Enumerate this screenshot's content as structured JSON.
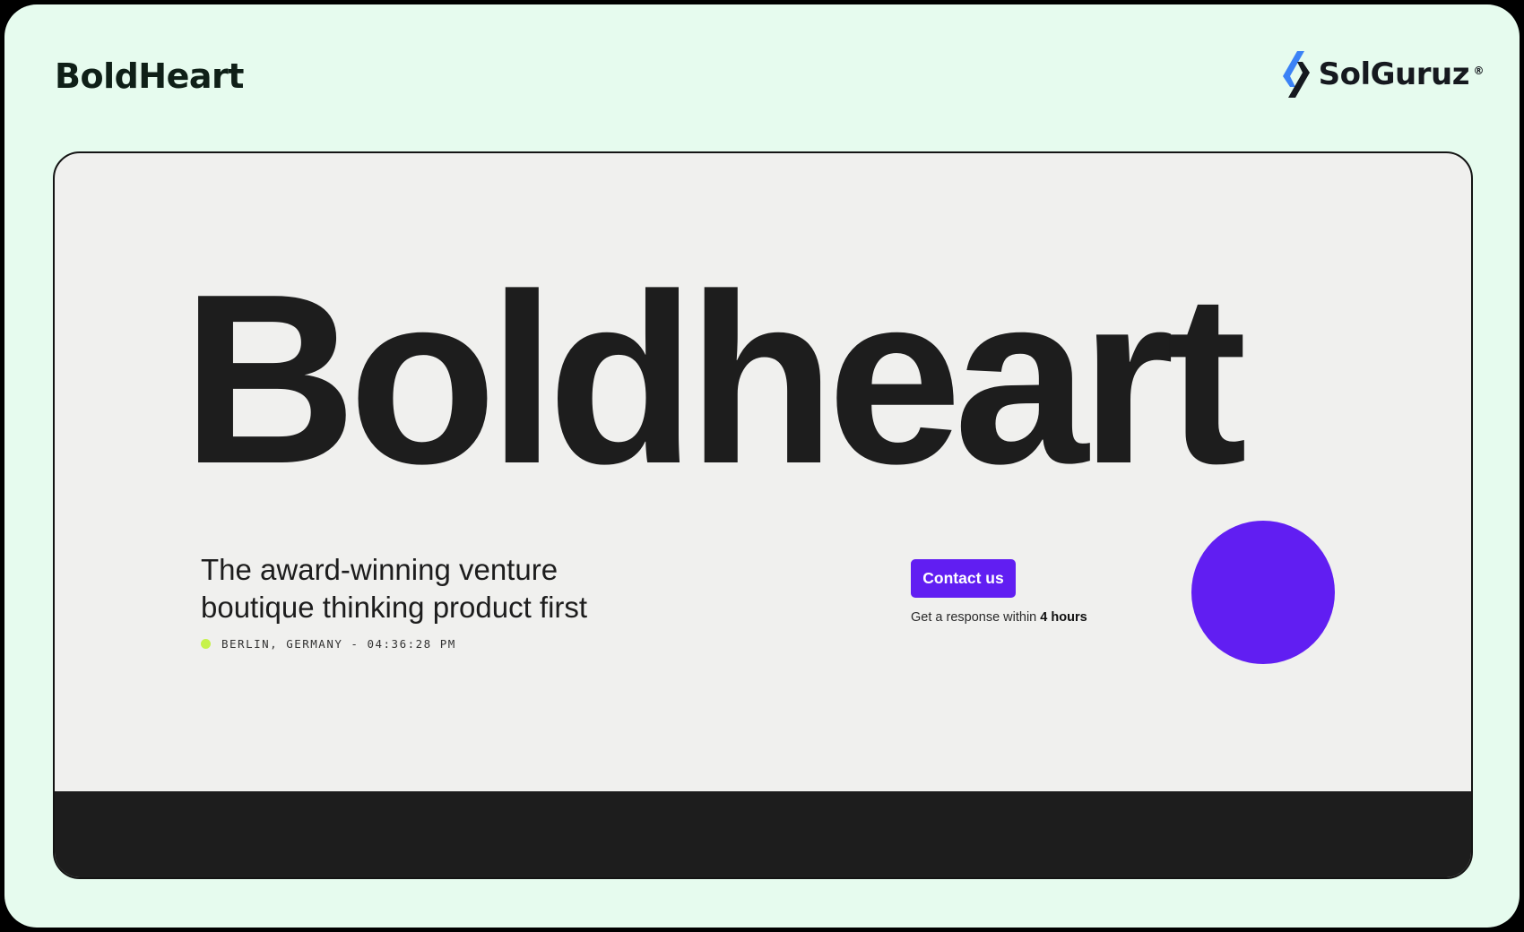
{
  "header": {
    "brand": "BoldHeart",
    "partner": {
      "name": "SolGuruz",
      "reg_mark": "®",
      "icon": "solguruz-logo-icon"
    }
  },
  "hero": {
    "headline": "Boldheart",
    "tagline_line1": "The award-winning venture",
    "tagline_line2": "boutique thinking product first",
    "location": "BERLIN, GERMANY - 04:36:28 PM",
    "contact_label": "Contact us",
    "response_prefix": "Get a response within ",
    "response_time": "4 hours"
  },
  "colors": {
    "page_bg": "#e6fbee",
    "screen_bg": "#f0f0ee",
    "text_dark": "#1d1d1d",
    "accent_purple": "#611ef2",
    "status_green": "#c6f24a",
    "logo_blue": "#3b82f6",
    "footer_band": "#1d1d1d"
  }
}
